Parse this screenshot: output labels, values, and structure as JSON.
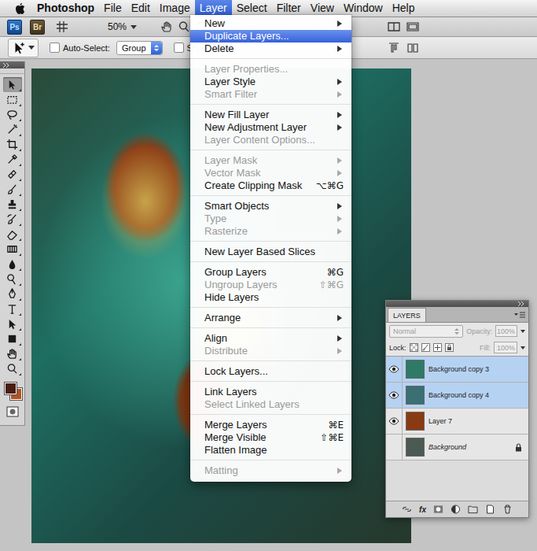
{
  "menubar": {
    "items": [
      {
        "label": "Photoshop",
        "kind": "app",
        "selected": false
      },
      {
        "label": "File",
        "kind": "menu",
        "selected": false
      },
      {
        "label": "Edit",
        "kind": "menu",
        "selected": false
      },
      {
        "label": "Image",
        "kind": "menu",
        "selected": false
      },
      {
        "label": "Layer",
        "kind": "menu",
        "selected": true
      },
      {
        "label": "Select",
        "kind": "menu",
        "selected": false
      },
      {
        "label": "Filter",
        "kind": "menu",
        "selected": false
      },
      {
        "label": "View",
        "kind": "menu",
        "selected": false
      },
      {
        "label": "Window",
        "kind": "menu",
        "selected": false
      },
      {
        "label": "Help",
        "kind": "menu",
        "selected": false
      }
    ]
  },
  "app_bar": {
    "ps_badge": "Ps",
    "br_badge": "Br",
    "zoom": "50%"
  },
  "options_bar": {
    "auto_select": {
      "label": "Auto-Select:",
      "checked": false
    },
    "auto_select_target": "Group",
    "show_transform": {
      "label": "Show Transfo",
      "checked": false
    }
  },
  "tools": [
    {
      "kind": "move",
      "selected": true
    },
    {
      "kind": "marquee",
      "selected": false
    },
    {
      "kind": "lasso",
      "selected": false
    },
    {
      "kind": "wand",
      "selected": false
    },
    {
      "kind": "crop",
      "selected": false
    },
    {
      "kind": "eyedropper",
      "selected": false
    },
    {
      "kind": "heal",
      "selected": false
    },
    {
      "kind": "brush",
      "selected": false
    },
    {
      "kind": "stamp",
      "selected": false
    },
    {
      "kind": "history",
      "selected": false
    },
    {
      "kind": "eraser",
      "selected": false
    },
    {
      "kind": "gradient",
      "selected": false
    },
    {
      "kind": "blur",
      "selected": false
    },
    {
      "kind": "dodge",
      "selected": false
    },
    {
      "kind": "pen",
      "selected": false
    },
    {
      "kind": "type",
      "selected": false
    },
    {
      "kind": "path-select",
      "selected": false
    },
    {
      "kind": "shape",
      "selected": false
    },
    {
      "kind": "hand",
      "selected": false
    },
    {
      "kind": "zoom",
      "selected": false
    }
  ],
  "swatches": {
    "foreground": "#4b1d12",
    "background": "#b4521f"
  },
  "menu": {
    "items": [
      {
        "kind": "item",
        "label": "New",
        "shortcut": "",
        "submenu": true,
        "disabled": false,
        "selected": false
      },
      {
        "kind": "item",
        "label": "Duplicate Layers...",
        "shortcut": "",
        "submenu": false,
        "disabled": false,
        "selected": true
      },
      {
        "kind": "item",
        "label": "Delete",
        "shortcut": "",
        "submenu": true,
        "disabled": false,
        "selected": false
      },
      {
        "kind": "separator"
      },
      {
        "kind": "item",
        "label": "Layer Properties...",
        "shortcut": "",
        "submenu": false,
        "disabled": true,
        "selected": false
      },
      {
        "kind": "item",
        "label": "Layer Style",
        "shortcut": "",
        "submenu": true,
        "disabled": false,
        "selected": false
      },
      {
        "kind": "item",
        "label": "Smart Filter",
        "shortcut": "",
        "submenu": true,
        "disabled": true,
        "selected": false
      },
      {
        "kind": "separator"
      },
      {
        "kind": "item",
        "label": "New Fill Layer",
        "shortcut": "",
        "submenu": true,
        "disabled": false,
        "selected": false
      },
      {
        "kind": "item",
        "label": "New Adjustment Layer",
        "shortcut": "",
        "submenu": true,
        "disabled": false,
        "selected": false
      },
      {
        "kind": "item",
        "label": "Layer Content Options...",
        "shortcut": "",
        "submenu": false,
        "disabled": true,
        "selected": false
      },
      {
        "kind": "separator"
      },
      {
        "kind": "item",
        "label": "Layer Mask",
        "shortcut": "",
        "submenu": true,
        "disabled": true,
        "selected": false
      },
      {
        "kind": "item",
        "label": "Vector Mask",
        "shortcut": "",
        "submenu": true,
        "disabled": true,
        "selected": false
      },
      {
        "kind": "item",
        "label": "Create Clipping Mask",
        "shortcut": "⌥⌘G",
        "submenu": false,
        "disabled": false,
        "selected": false
      },
      {
        "kind": "separator"
      },
      {
        "kind": "item",
        "label": "Smart Objects",
        "shortcut": "",
        "submenu": true,
        "disabled": false,
        "selected": false
      },
      {
        "kind": "item",
        "label": "Type",
        "shortcut": "",
        "submenu": true,
        "disabled": true,
        "selected": false
      },
      {
        "kind": "item",
        "label": "Rasterize",
        "shortcut": "",
        "submenu": true,
        "disabled": true,
        "selected": false
      },
      {
        "kind": "separator"
      },
      {
        "kind": "item",
        "label": "New Layer Based Slices",
        "shortcut": "",
        "submenu": false,
        "disabled": false,
        "selected": false
      },
      {
        "kind": "separator"
      },
      {
        "kind": "item",
        "label": "Group Layers",
        "shortcut": "⌘G",
        "submenu": false,
        "disabled": false,
        "selected": false
      },
      {
        "kind": "item",
        "label": "Ungroup Layers",
        "shortcut": "⇧⌘G",
        "submenu": false,
        "disabled": true,
        "selected": false
      },
      {
        "kind": "item",
        "label": "Hide Layers",
        "shortcut": "",
        "submenu": false,
        "disabled": false,
        "selected": false
      },
      {
        "kind": "separator"
      },
      {
        "kind": "item",
        "label": "Arrange",
        "shortcut": "",
        "submenu": true,
        "disabled": false,
        "selected": false
      },
      {
        "kind": "separator"
      },
      {
        "kind": "item",
        "label": "Align",
        "shortcut": "",
        "submenu": true,
        "disabled": false,
        "selected": false
      },
      {
        "kind": "item",
        "label": "Distribute",
        "shortcut": "",
        "submenu": true,
        "disabled": true,
        "selected": false
      },
      {
        "kind": "separator"
      },
      {
        "kind": "item",
        "label": "Lock Layers...",
        "shortcut": "",
        "submenu": false,
        "disabled": false,
        "selected": false
      },
      {
        "kind": "separator"
      },
      {
        "kind": "item",
        "label": "Link Layers",
        "shortcut": "",
        "submenu": false,
        "disabled": false,
        "selected": false
      },
      {
        "kind": "item",
        "label": "Select Linked Layers",
        "shortcut": "",
        "submenu": false,
        "disabled": true,
        "selected": false
      },
      {
        "kind": "separator"
      },
      {
        "kind": "item",
        "label": "Merge Layers",
        "shortcut": "⌘E",
        "submenu": false,
        "disabled": false,
        "selected": false
      },
      {
        "kind": "item",
        "label": "Merge Visible",
        "shortcut": "⇧⌘E",
        "submenu": false,
        "disabled": false,
        "selected": false
      },
      {
        "kind": "item",
        "label": "Flatten Image",
        "shortcut": "",
        "submenu": false,
        "disabled": false,
        "selected": false
      },
      {
        "kind": "separator"
      },
      {
        "kind": "item",
        "label": "Matting",
        "shortcut": "",
        "submenu": true,
        "disabled": true,
        "selected": false
      }
    ]
  },
  "layers_panel": {
    "title": "LAYERS",
    "blend_mode": "Normal",
    "opacity_label": "Opacity:",
    "opacity": "100%",
    "lock_label": "Lock:",
    "fill_label": "Fill:",
    "fill": "100%",
    "controls_disabled": true,
    "footer_fx": "fx",
    "layers": [
      {
        "name": "Background copy 3",
        "visible": true,
        "selected": true,
        "locked": false,
        "kind": "normal",
        "color": "#2d7a66"
      },
      {
        "name": "Background copy 4",
        "visible": true,
        "selected": true,
        "locked": false,
        "kind": "normal",
        "color": "#3a6f73"
      },
      {
        "name": "Layer 7",
        "visible": true,
        "selected": false,
        "locked": false,
        "kind": "normal",
        "color": "#8a3a12"
      },
      {
        "name": "Background",
        "visible": false,
        "selected": false,
        "locked": true,
        "kind": "background",
        "color": "#4b5a52"
      }
    ]
  }
}
